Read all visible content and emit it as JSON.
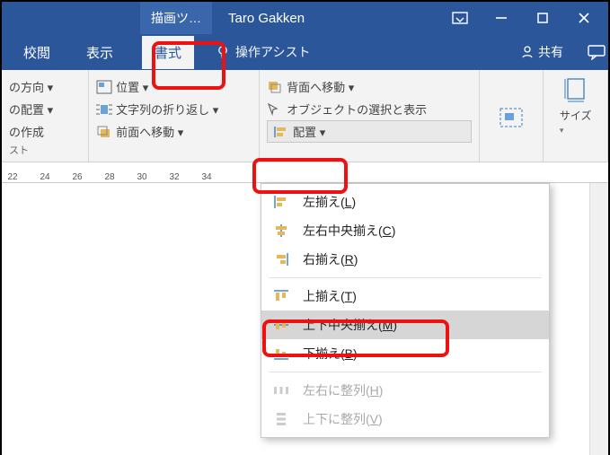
{
  "title": {
    "tool_tab": "描画ツ…",
    "user": "Taro Gakken"
  },
  "tabs": {
    "review": "校閲",
    "view": "表示",
    "format": "書式",
    "tellme": "操作アシスト",
    "share": "共有"
  },
  "ribbon": {
    "g1": {
      "a": "の方向 ▾",
      "b": "の配置 ▾",
      "c": "の作成"
    },
    "g2": {
      "pos": "位置 ▾",
      "wrap": "文字列の折り返し ▾",
      "front": "前面へ移動  ▾"
    },
    "g3": {
      "back": "背面へ移動  ▾",
      "sel": "オブジェクトの選択と表示",
      "align": "配置 ▾"
    },
    "size": "サイズ",
    "label_left": "スト"
  },
  "ruler": [
    "22",
    "24",
    "26",
    "28",
    "30",
    "32",
    "34"
  ],
  "menu": {
    "left": {
      "t": "左揃え(",
      "k": "L",
      "e": ")"
    },
    "hcenter": {
      "t": "左右中央揃え(",
      "k": "C",
      "e": ")"
    },
    "right": {
      "t": "右揃え(",
      "k": "R",
      "e": ")"
    },
    "top": {
      "t": "上揃え(",
      "k": "T",
      "e": ")"
    },
    "vcenter": {
      "t": "上下中央揃え(",
      "k": "M",
      "e": ")"
    },
    "bottom": {
      "t": "下揃え(",
      "k": "B",
      "e": ")"
    },
    "disth": {
      "t": "左右に整列(",
      "k": "H",
      "e": ")"
    },
    "distv": {
      "t": "上下に整列(",
      "k": "V",
      "e": ")"
    }
  }
}
